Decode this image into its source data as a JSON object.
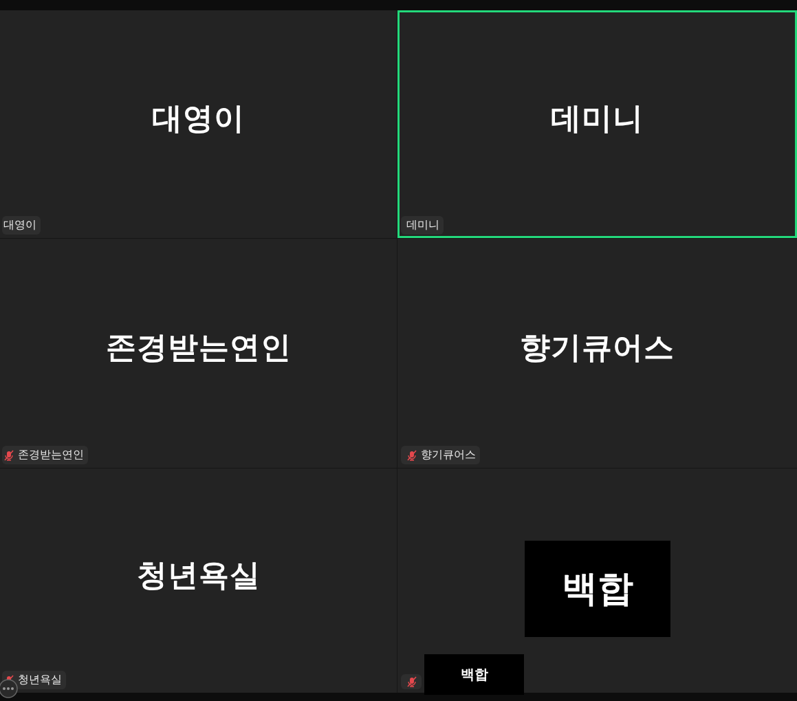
{
  "tiles": [
    {
      "kind": "name",
      "name": "대영이",
      "label": "대영이",
      "muted": false,
      "speaking": false
    },
    {
      "kind": "name",
      "name": "데미니",
      "label": "데미니",
      "muted": false,
      "speaking": true
    },
    {
      "kind": "name",
      "name": "존경받는연인",
      "label": "존경받는연인",
      "muted": true,
      "speaking": false
    },
    {
      "kind": "name",
      "name": "향기큐어스",
      "label": "향기큐어스",
      "muted": true,
      "speaking": false
    },
    {
      "kind": "name",
      "name": "청년욕실",
      "label": "청년욕실",
      "muted": true,
      "speaking": false
    },
    {
      "kind": "avatar",
      "name": "백합",
      "muted": true,
      "speaking": false
    }
  ],
  "floating_name": {
    "text": "백합"
  }
}
